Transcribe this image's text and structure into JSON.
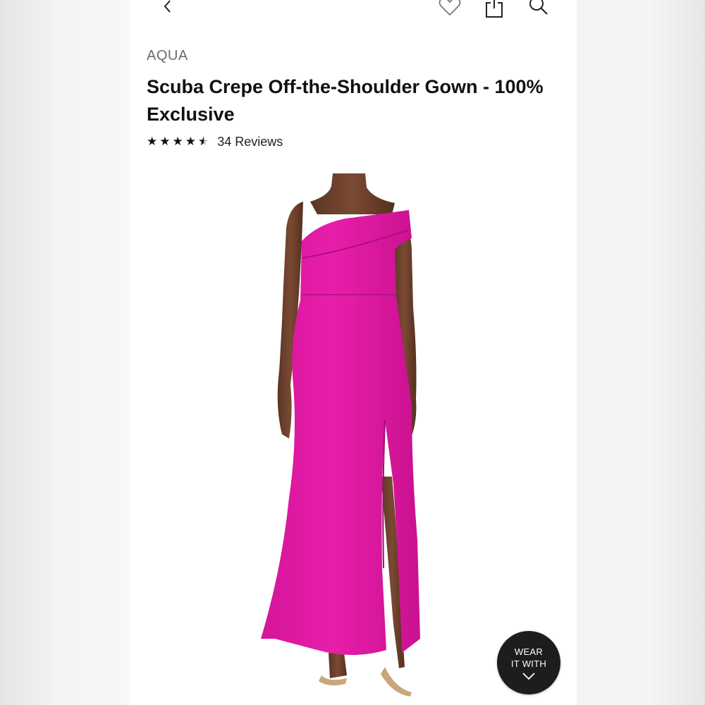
{
  "header": {
    "back_icon": "chevron-left-icon",
    "favorite_icon": "heart-icon",
    "share_icon": "share-icon",
    "search_icon": "search-icon"
  },
  "product": {
    "brand": "AQUA",
    "title": "Scuba Crepe Off-the-Shoulder Gown - 100% Exclusive",
    "rating": 4.5,
    "rating_max": 5,
    "reviews_label": "34 Reviews",
    "dress_color": "#e51ca8"
  },
  "wear_it_with": {
    "line1": "WEAR",
    "line2": "IT WITH",
    "icon": "chevron-down-icon"
  }
}
